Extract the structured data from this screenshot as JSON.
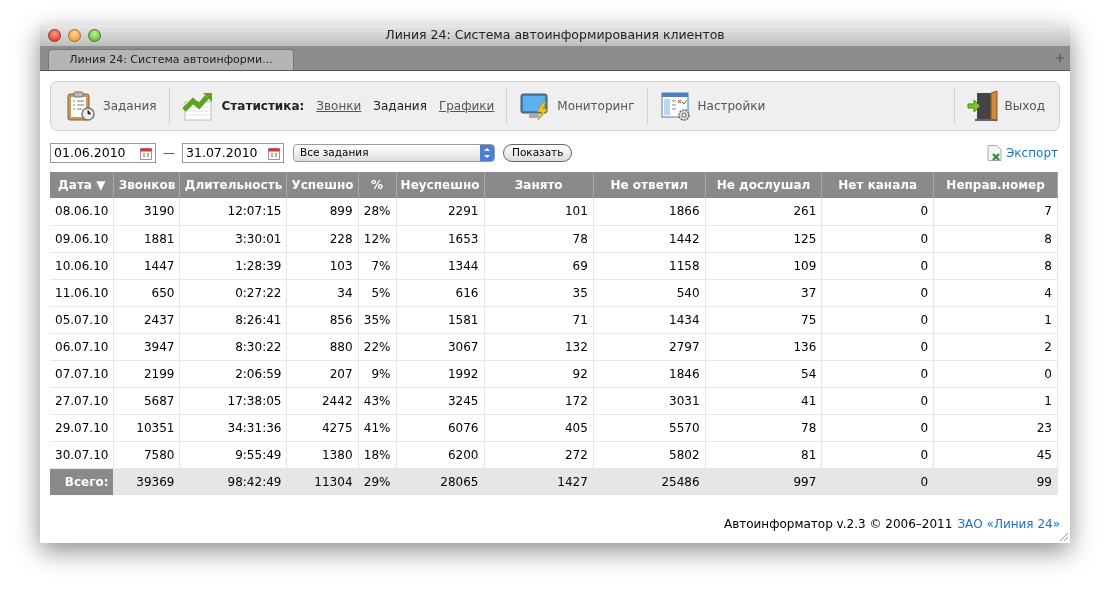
{
  "window": {
    "title": "Линия 24: Система автоинформирования клиентов"
  },
  "tabs": [
    {
      "label": "Линия 24: Система автоинформи...",
      "selected": true
    }
  ],
  "toolbar": {
    "items": [
      {
        "kind": "tasks",
        "label": "Задания"
      },
      {
        "kind": "stats",
        "label": "Статистика:",
        "links": [
          {
            "label": "Звонки",
            "selected": false
          },
          {
            "label": "Задания",
            "selected": true
          },
          {
            "label": "Графики",
            "selected": false
          }
        ]
      },
      {
        "kind": "monitor",
        "label": "Мониторинг"
      },
      {
        "kind": "settings",
        "label": "Настройки"
      },
      {
        "kind": "exit",
        "label": "Выход"
      }
    ]
  },
  "filters": {
    "date_from": "01.06.2010",
    "separator": "—",
    "date_to": "31.07.2010",
    "task_select": "Все задания",
    "show_button": "Показать",
    "export_link": "Экспорт"
  },
  "table": {
    "columns": [
      "Дата ▼",
      "Звонков",
      "Длительность",
      "Успешно",
      "%",
      "Неуспешно",
      "Занято",
      "Не ответил",
      "Не дослушал",
      "Нет канала",
      "Неправ.номер"
    ],
    "rows": [
      [
        "08.06.10",
        "3190",
        "12:07:15",
        "899",
        "28%",
        "2291",
        "101",
        "1866",
        "261",
        "0",
        "7"
      ],
      [
        "09.06.10",
        "1881",
        "3:30:01",
        "228",
        "12%",
        "1653",
        "78",
        "1442",
        "125",
        "0",
        "8"
      ],
      [
        "10.06.10",
        "1447",
        "1:28:39",
        "103",
        "7%",
        "1344",
        "69",
        "1158",
        "109",
        "0",
        "8"
      ],
      [
        "11.06.10",
        "650",
        "0:27:22",
        "34",
        "5%",
        "616",
        "35",
        "540",
        "37",
        "0",
        "4"
      ],
      [
        "05.07.10",
        "2437",
        "8:26:41",
        "856",
        "35%",
        "1581",
        "71",
        "1434",
        "75",
        "0",
        "1"
      ],
      [
        "06.07.10",
        "3947",
        "8:30:22",
        "880",
        "22%",
        "3067",
        "132",
        "2797",
        "136",
        "0",
        "2"
      ],
      [
        "07.07.10",
        "2199",
        "2:06:59",
        "207",
        "9%",
        "1992",
        "92",
        "1846",
        "54",
        "0",
        "0"
      ],
      [
        "27.07.10",
        "5687",
        "17:38:05",
        "2442",
        "43%",
        "3245",
        "172",
        "3031",
        "41",
        "0",
        "1"
      ],
      [
        "29.07.10",
        "10351",
        "34:31:36",
        "4275",
        "41%",
        "6076",
        "405",
        "5570",
        "78",
        "0",
        "23"
      ],
      [
        "30.07.10",
        "7580",
        "9:55:49",
        "1380",
        "18%",
        "6200",
        "272",
        "5802",
        "81",
        "0",
        "45"
      ]
    ],
    "totals": [
      "Всего:",
      "39369",
      "98:42:49",
      "11304",
      "29%",
      "28065",
      "1427",
      "25486",
      "997",
      "0",
      "99"
    ]
  },
  "footer": {
    "text": "Автоинформатор v.2.3 © 2006–2011",
    "link": "ЗАО «Линия 24»"
  }
}
